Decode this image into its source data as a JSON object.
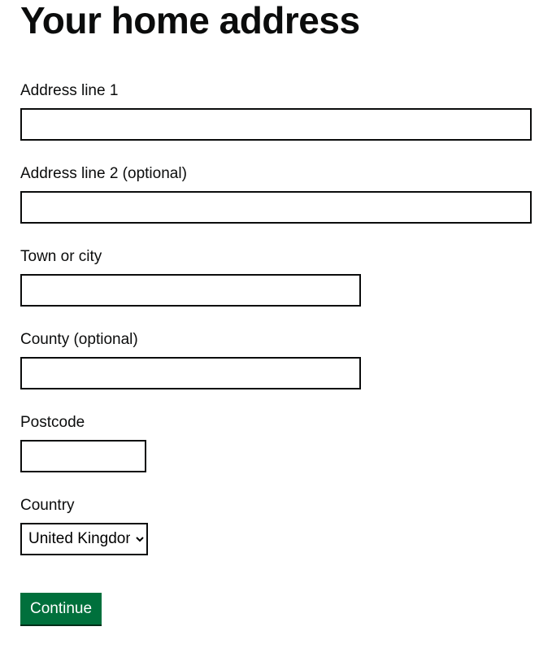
{
  "heading": "Your home address",
  "fields": {
    "address1": {
      "label": "Address line 1",
      "value": ""
    },
    "address2": {
      "label": "Address line 2 (optional)",
      "value": ""
    },
    "town": {
      "label": "Town or city",
      "value": ""
    },
    "county": {
      "label": "County (optional)",
      "value": ""
    },
    "postcode": {
      "label": "Postcode",
      "value": ""
    },
    "country": {
      "label": "Country",
      "value": "United Kingdom"
    }
  },
  "button": {
    "continue": "Continue"
  }
}
